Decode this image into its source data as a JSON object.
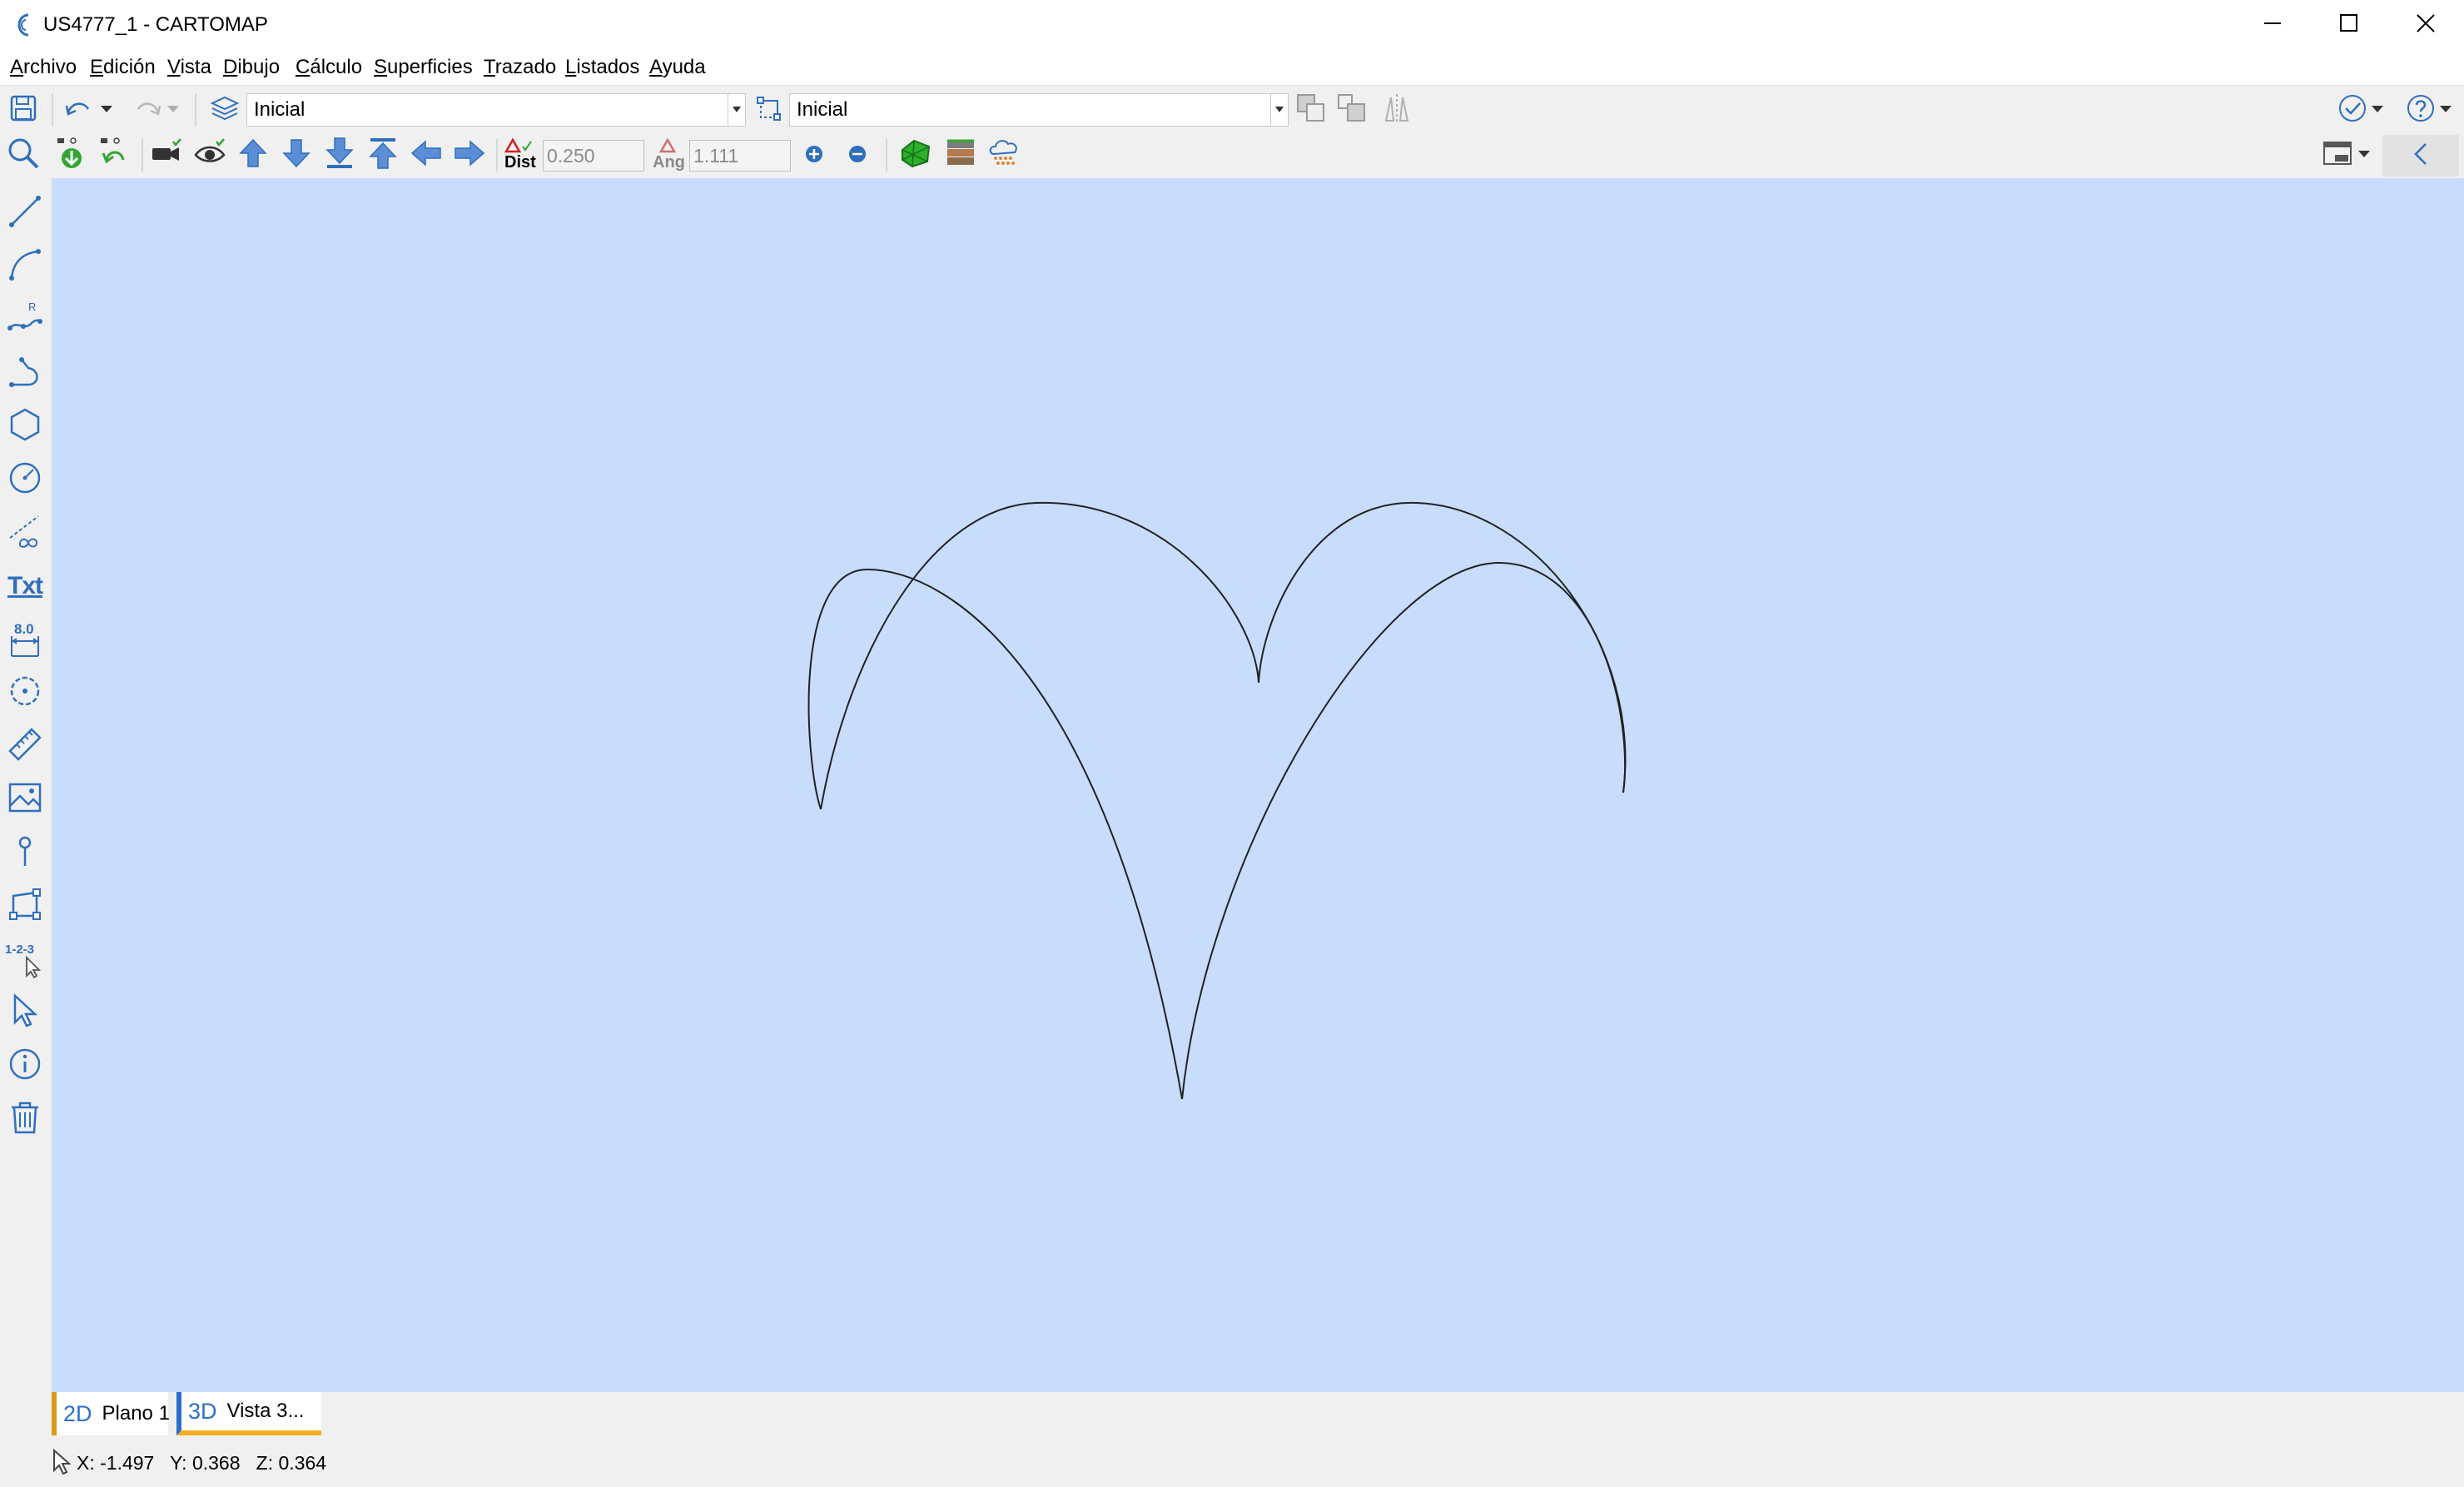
{
  "window": {
    "title": "US4777_1 - CARTOMAP",
    "icons": [
      "minimize-icon",
      "maximize-icon",
      "close-icon"
    ]
  },
  "menu": [
    {
      "label": "Archivo",
      "ul": "A",
      "rest": "rchivo"
    },
    {
      "label": "Edición",
      "ul": "E",
      "rest": "dición"
    },
    {
      "label": "Vista",
      "ul": "V",
      "rest": "ista"
    },
    {
      "label": "Dibujo",
      "ul": "D",
      "rest": "ibujo"
    },
    {
      "label": "Cálculo",
      "ul": "C",
      "rest": "álculo"
    },
    {
      "label": "Superficies",
      "ul": "S",
      "rest": "uperficies"
    },
    {
      "label": "Trazado",
      "ul": "T",
      "rest": "razado"
    },
    {
      "label": "Listados",
      "ul": "L",
      "rest": "istados"
    },
    {
      "label": "Ayuda",
      "ul": "A",
      "rest": "yuda"
    }
  ],
  "toolbar": {
    "layer_value": "Inicial",
    "style_value": "Inicial"
  },
  "toolbar2": {
    "dist_label": "Dist",
    "dist_value": "0.250",
    "ang_label": "Ang",
    "ang_value": "1.111"
  },
  "left_tools": {
    "text_tool_label": "Txt",
    "dimension_tool_label": "8.0",
    "numbering_tool_label": "1-2-3",
    "radius_label": "R"
  },
  "tabs": [
    {
      "dim": "2D",
      "label": "Plano 1",
      "accent": "#d69a18"
    },
    {
      "dim": "3D",
      "label": "Vista 3...",
      "accent": "#2b6ecf",
      "active": true,
      "underline": "#f0b020"
    }
  ],
  "status": {
    "coords": "X: -1.497   Y: 0.368   Z: 0.364"
  },
  "colors": {
    "canvas": "#c8ddfb",
    "icon_blue": "#2f6fbd",
    "curve": "#222222"
  }
}
